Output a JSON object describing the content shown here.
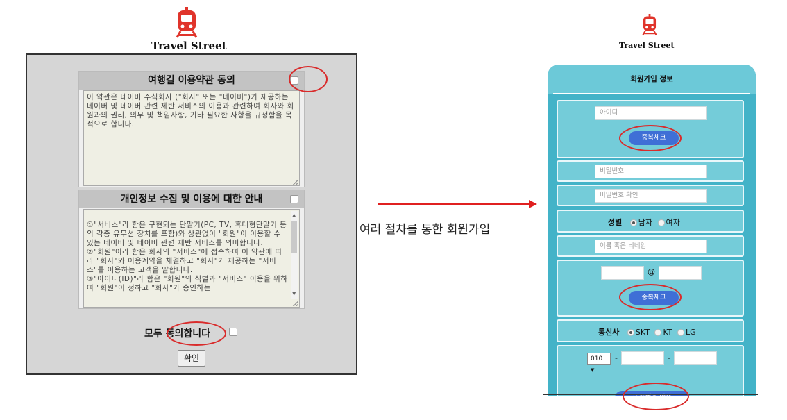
{
  "left_screen": {
    "brand": "Travel Street",
    "terms": {
      "title": "여행길 이용약관 동의",
      "body": "이 약관은 네이버 주식회사 (\"회사\" 또는 \"네이버\")가 제공하는 네이버 및 네이버 관련 제반 서비스의 이용과 관련하여 회사와 회원과의 권리, 의무 및 책임사항, 기타 필요한 사항을 규정함을 목적으로 합니다."
    },
    "privacy": {
      "title": "개인정보 수집 및 이용에 대한 안내",
      "body": "①\"서비스\"라 함은 구현되는 단말기(PC, TV, 휴대형단말기 등의 각종 유무선 장치를 포함)와 상관없이 \"회원\"이 이용할 수 있는 네이버 및 네이버 관련 제반 서비스를 의미합니다.\n②\"회원\"이라 함은 회사의 \"서비스\"에 접속하여 이 약관에 따라 \"회사\"와 이용계약을 체결하고 \"회사\"가 제공하는 \"서비스\"를 이용하는 고객을 말합니다.\n③\"아이디(ID)\"라 함은 \"회원\"의 식별과 \"서비스\" 이용을 위하여 \"회원\"이 정하고 \"회사\"가 승인하는"
    },
    "agree_all_label": "모두 동의합니다",
    "confirm_label": "확인"
  },
  "caption": "여러 절차를 통한 회원가입",
  "right_screen": {
    "brand": "Travel Street",
    "header_title": "회원가입 정보",
    "id_placeholder": "아이디",
    "dup_check_label": "중복체크",
    "password_placeholder": "비밀번호",
    "password_confirm_placeholder": "비밀번호 확인",
    "gender_label": "성별",
    "gender_options": [
      "남자",
      "여자"
    ],
    "gender_selected": "남자",
    "name_placeholder": "이름 혹은 닉네임",
    "email_at": "@",
    "email_dup_check_label": "중복체크",
    "carrier_label": "통신사",
    "carrier_options": [
      "SKT",
      "KT",
      "LG"
    ],
    "carrier_selected": "SKT",
    "phone_prefix": "010",
    "phone_separator": "-",
    "send_code_label": "인증번호 발송"
  },
  "colors": {
    "annotation_red": "#d92b2b",
    "form_teal": "#43b3c8",
    "button_blue": "#3f6fd6",
    "logo_red": "#e0342b"
  }
}
